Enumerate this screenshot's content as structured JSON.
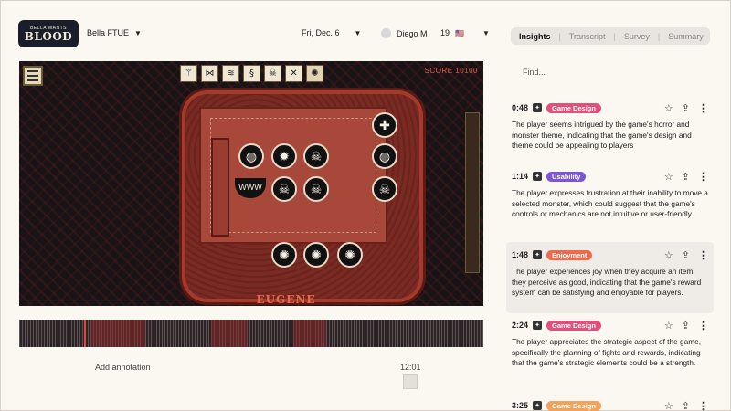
{
  "logo": {
    "line1": "BELLA WANTS",
    "line2": "BLOOD"
  },
  "header": {
    "project": "Bella FTUE",
    "date": "Fri, Dec. 6",
    "user": "Diego M",
    "age": "19",
    "flag": "🇺🇸"
  },
  "game": {
    "score": "SCORE 10100",
    "character_name": "EUGENE",
    "toolbar_icons": [
      "rune-icon-1",
      "rune-icon-2",
      "rune-icon-3",
      "rune-icon-4",
      "rune-icon-5",
      "rune-icon-6",
      "gear-icon"
    ],
    "mouth_text": "WWW"
  },
  "timeline": {
    "add_annotation": "Add annotation",
    "duration": "12:01",
    "progress": 0.14
  },
  "panel": {
    "tabs": [
      "Insights",
      "Transcript",
      "Survey",
      "Summary"
    ],
    "active_tab": "Insights",
    "search_placeholder": "Find...",
    "insights": [
      {
        "time": "0:48",
        "tag": "Game Design",
        "tag_color": "#e0507a",
        "text": "The player seems intrigued by the game's horror and monster theme, indicating that the game's design and theme could be appealing to players"
      },
      {
        "time": "1:14",
        "tag": "Usability",
        "tag_color": "#7a55d9",
        "text": "The player expresses frustration at their inability to move a selected monster, which could suggest that the game's controls or mechanics are not intuitive or user-friendly."
      },
      {
        "time": "1:48",
        "tag": "Enjoyment",
        "tag_color": "#ee6a4d",
        "text": "The player experiences joy when they acquire an item they perceive as good, indicating that the game's reward system can be satisfying and enjoyable for players."
      },
      {
        "time": "2:24",
        "tag": "Game Design",
        "tag_color": "#e0507a",
        "text": "The player appreciates the strategic aspect of the game, specifically the planning of fights and rewards, indicating that the game's strategic elements could be a strength."
      },
      {
        "time": "3:25",
        "tag": "Game Design",
        "tag_color": "#f4a15a",
        "text": ""
      }
    ]
  }
}
